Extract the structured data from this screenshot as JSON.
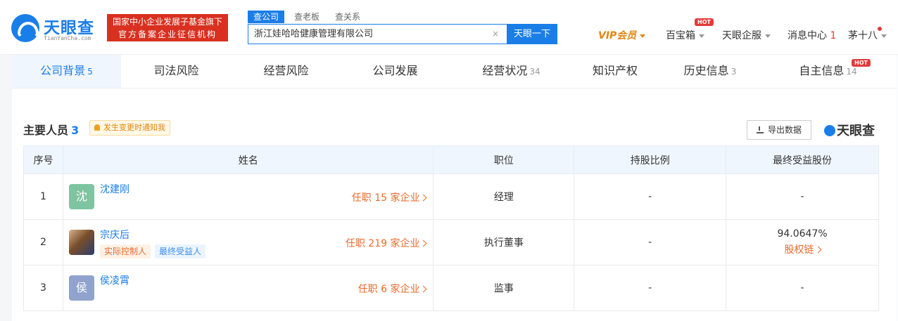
{
  "header": {
    "logo_text": "天眼查",
    "logo_sub": "TianYanCha.com",
    "promo_line1": "国家中小企业发展子基金旗下",
    "promo_line2": "官方备案企业征信机构",
    "search_tabs": [
      "查公司",
      "查老板",
      "查关系"
    ],
    "search_value": "浙江娃哈哈健康管理有限公司",
    "clear_symbol": "×",
    "search_button": "天眼一下",
    "nav": {
      "vip": "VIP会员",
      "baobox": "百宝箱",
      "enterprise": "天眼企服",
      "messages": "消息中心",
      "message_count": "1",
      "user": "茅十八",
      "hot_label": "HOT"
    }
  },
  "tabs": [
    {
      "label": "公司背景",
      "count": "5"
    },
    {
      "label": "司法风险",
      "count": ""
    },
    {
      "label": "经营风险",
      "count": ""
    },
    {
      "label": "公司发展",
      "count": ""
    },
    {
      "label": "经营状况",
      "count": "34"
    },
    {
      "label": "知识产权",
      "count": ""
    },
    {
      "label": "历史信息",
      "count": "3"
    },
    {
      "label": "自主信息",
      "count": "14"
    }
  ],
  "section": {
    "title": "主要人员",
    "count": "3",
    "notify": "发生变更时通知我",
    "export": "导出数据",
    "watermark": "天眼查"
  },
  "table": {
    "headers": [
      "序号",
      "姓名",
      "职位",
      "持股比例",
      "最终受益股份"
    ],
    "rows": [
      {
        "no": "1",
        "avatar_char": "沈",
        "avatar_color": "#7fc4a0",
        "name": "沈建刚",
        "tags": [],
        "jobs": "任职 15 家企业",
        "position": "经理",
        "share": "-",
        "benefit": "-",
        "benefit_link": ""
      },
      {
        "no": "2",
        "avatar_char": "",
        "avatar_color": "",
        "name": "宗庆后",
        "tags": [
          "实际控制人",
          "最终受益人"
        ],
        "jobs": "任职 219 家企业",
        "position": "执行董事",
        "share": "-",
        "benefit": "94.0647%",
        "benefit_link": "股权链"
      },
      {
        "no": "3",
        "avatar_char": "侯",
        "avatar_color": "#8fa3cc",
        "name": "侯凌霄",
        "tags": [],
        "jobs": "任职 6 家企业",
        "position": "监事",
        "share": "-",
        "benefit": "-",
        "benefit_link": ""
      }
    ]
  }
}
